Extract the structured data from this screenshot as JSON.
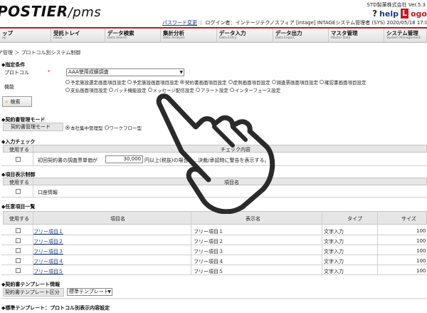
{
  "header": {
    "logo_main": "POSTIER",
    "logo_suffix": "/pms",
    "company": "STD製薬株式会社 Ver.5.3",
    "help_q": "?",
    "help_label": "help",
    "logout_box": "L",
    "logout_text": "ogo",
    "password_change": "パスワード変更",
    "user_line": "ログイン者：インテージテクノスフィア [intage] INTAGEシステム管理者 (SYS)  2020/05/18 17:05"
  },
  "nav": [
    {
      "jp": "ップ",
      "en": "op",
      "w": 72
    },
    {
      "jp": "受託トレイ",
      "en": "Inbox",
      "w": 76
    },
    {
      "jp": "データ検索",
      "en": "Data Search",
      "w": 78
    },
    {
      "jp": "集計分析",
      "en": "Data Analysis",
      "w": 79
    },
    {
      "jp": "データ入力",
      "en": "Data Entry",
      "w": 79
    },
    {
      "jp": "データ出力",
      "en": "Data Export",
      "w": 78
    },
    {
      "jp": "マスタ管理",
      "en": "Master Data",
      "w": 78
    },
    {
      "jp": "システム管理",
      "en": "System Management",
      "w": 60
    }
  ],
  "breadcrumb": "ア管理 ＞ プロトコル別システム制御",
  "cond": {
    "title": "◆指定条件",
    "protocol_label": "プロトコル",
    "required_mark": "*",
    "protocol_value": "AAA使用成績調査",
    "func_label": "機能",
    "func_options_row1": [
      {
        "label": "予定施設選定画面項目設定",
        "on": false
      },
      {
        "label": "予定施設画面項目設定",
        "on": false
      },
      {
        "label": "契約書画面項目設定",
        "on": true
      },
      {
        "label": "症例画面項目設定",
        "on": false
      },
      {
        "label": "調査票画面項目設定",
        "on": false
      },
      {
        "label": "確認書画面項目設定",
        "on": false
      }
    ],
    "func_options_row2": [
      {
        "label": "支払画面項目設定",
        "on": false
      },
      {
        "label": "バッチ機能設定",
        "on": false
      },
      {
        "label": "メッセージ配信設定",
        "on": false
      },
      {
        "label": "アラート設定",
        "on": false
      },
      {
        "label": "インターフェース設定",
        "on": false
      }
    ],
    "search_button": "検索"
  },
  "mode": {
    "title": "◆契約書管理モード",
    "label": "契約書管理モード",
    "options": [
      {
        "label": "本社集中管理型",
        "on": true
      },
      {
        "label": "ワークフロー型",
        "on": false
      }
    ]
  },
  "check": {
    "title": "◆入力チェック",
    "col_use": "使用する",
    "col_content": "チェック内容",
    "text_before": "初回契約書の調査票単価が",
    "amount": "30,000",
    "text_after": "円以上(税抜)の場合、...決裁/承認時に警告を表示する。"
  },
  "display": {
    "title": "◆項目表示制御",
    "col_use": "使用する",
    "col_item": "項目名",
    "row_item": "口座情報"
  },
  "optional": {
    "title": "◆任意項目一覧",
    "cols": [
      "使用する",
      "項目名",
      "表示名",
      "タイプ",
      "サイズ"
    ],
    "rows": [
      {
        "item": "フリー項目１",
        "display": "フリー項目１",
        "type": "文字入力",
        "size": "100"
      },
      {
        "item": "フリー項目２",
        "display": "フリー項目２",
        "type": "文字入力",
        "size": "100"
      },
      {
        "item": "フリー項目３",
        "display": "フリー項目３",
        "type": "文字入力",
        "size": "100"
      },
      {
        "item": "フリー項目４",
        "display": "フリー項目４",
        "type": "文字入力",
        "size": "100"
      },
      {
        "item": "フリー項目５",
        "display": "フリー項目５",
        "type": "文字入力",
        "size": "100"
      }
    ]
  },
  "template": {
    "title": "◆契約書テンプレート情報",
    "label": "契約書テンプレート区分",
    "value": "標準テンプレート"
  },
  "footer_title": "◆標準テンプレート：プロトコル別表示内容設定",
  "colors": {
    "brand_red": "#c8161d",
    "link_blue": "#1a3d8a",
    "header_grey": "#e6e6e6"
  }
}
